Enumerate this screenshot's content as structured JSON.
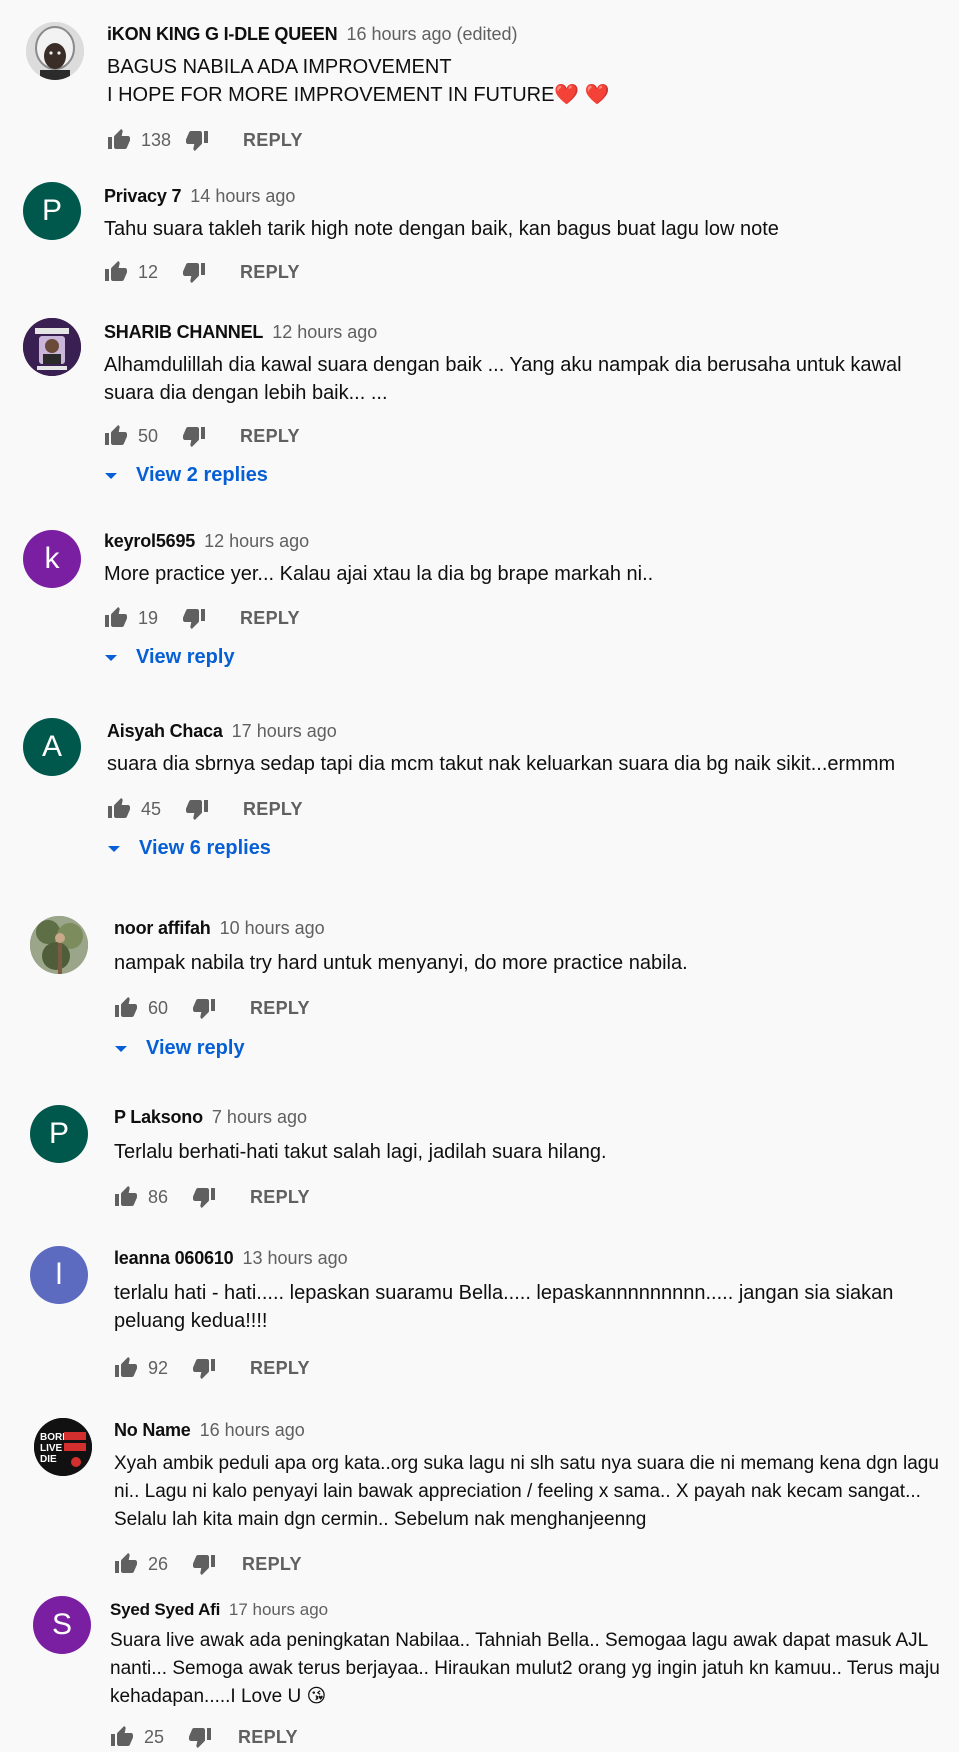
{
  "reply_label": "REPLY",
  "comments": [
    {
      "author": "iKON KING G I-DLE QUEEN",
      "time": "16 hours ago (edited)",
      "text": "BAGUS NABILA ADA IMPROVEMENT\nI HOPE FOR MORE IMPROVEMENT IN FUTURE❤️ ❤️",
      "likes": "138",
      "avatar_letter": "",
      "avatar_color": "#d0d0d0"
    },
    {
      "author": "Privacy 7",
      "time": "14 hours ago",
      "text": "Tahu suara takleh tarik high note dengan baik, kan bagus buat lagu low note",
      "likes": "12",
      "avatar_letter": "P",
      "avatar_color": "#00574b"
    },
    {
      "author": "SHARIB CHANNEL",
      "time": "12 hours ago",
      "text": "Alhamdulillah dia kawal suara dengan baik ... Yang aku nampak dia berusaha untuk kawal suara dia dengan lebih baik... ...",
      "likes": "50",
      "avatar_letter": "",
      "avatar_color": "#3a1f52",
      "replies_label": "View 2 replies"
    },
    {
      "author": "keyrol5695",
      "time": "12 hours ago",
      "text": "More practice yer... Kalau ajai xtau la dia bg brape markah ni..",
      "likes": "19",
      "avatar_letter": "k",
      "avatar_color": "#7b1fa2",
      "replies_label": "View reply"
    },
    {
      "author": "Aisyah Chaca",
      "time": "17 hours ago",
      "text": "suara dia sbrnya sedap tapi dia mcm takut nak keluarkan suara dia bg naik sikit...ermmm",
      "likes": "45",
      "avatar_letter": "A",
      "avatar_color": "#00574b",
      "replies_label": "View 6 replies"
    },
    {
      "author": "noor affifah",
      "time": "10 hours ago",
      "text": "nampak nabila try hard untuk menyanyi, do more practice nabila.",
      "likes": "60",
      "avatar_letter": "",
      "avatar_color": "#6b7a5a",
      "replies_label": "View reply"
    },
    {
      "author": "P Laksono",
      "time": "7 hours ago",
      "text": "Terlalu berhati-hati takut salah lagi, jadilah suara hilang.",
      "likes": "86",
      "avatar_letter": "P",
      "avatar_color": "#00574b"
    },
    {
      "author": "leanna 060610",
      "time": "13 hours ago",
      "text": "terlalu hati - hati..... lepaskan suaramu Bella..... lepaskannnnnnnnn..... jangan sia siakan peluang kedua!!!!",
      "likes": "92",
      "avatar_letter": "l",
      "avatar_color": "#5c6bc0"
    },
    {
      "author": "No Name",
      "time": "16 hours ago",
      "text": "Xyah ambik peduli apa org kata..org suka lagu ni slh satu nya suara die ni memang kena dgn lagu ni.. Lagu ni kalo penyayi  lain bawak appreciation / feeling x sama..  X payah nak kecam sangat...  Selalu lah kita main dgn cermin.. Sebelum nak menghanjeenng",
      "likes": "26",
      "avatar_letter": "",
      "avatar_color": "#111111",
      "avatar_text": "BORN LIVE DIE"
    },
    {
      "author": "Syed Syed Afi",
      "time": "17 hours ago",
      "text": "Suara live awak ada peningkatan Nabilaa.. Tahniah Bella.. Semogaa lagu awak dapat masuk AJL nanti... Semoga awak terus berjayaa.. Hiraukan mulut2 orang yg ingin jatuh kn kamuu.. Terus maju kehadapan.....I Love U 😘",
      "likes": "25",
      "avatar_letter": "S",
      "avatar_color": "#7b1fa2"
    }
  ]
}
